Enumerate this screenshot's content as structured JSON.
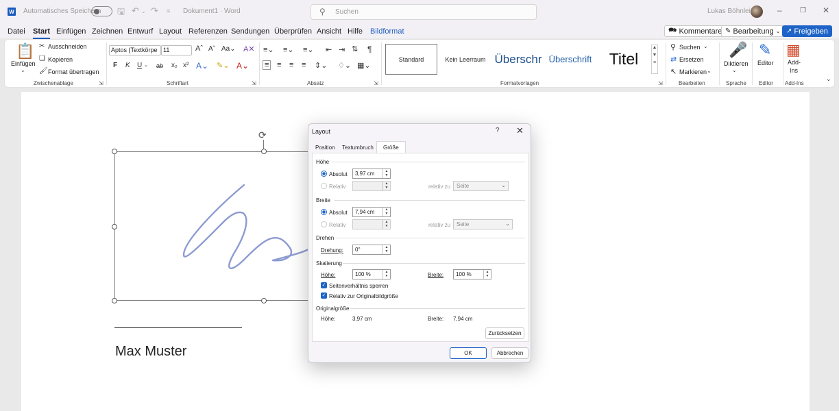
{
  "titlebar": {
    "autosave_label": "Automatisches Speichern",
    "document_name": "Dokument1 · Word",
    "search_placeholder": "Suchen",
    "user_name": "Lukas Böhnlein"
  },
  "menu": {
    "tabs": [
      "Datei",
      "Start",
      "Einfügen",
      "Zeichnen",
      "Entwurf",
      "Layout",
      "Referenzen",
      "Sendungen",
      "Überprüfen",
      "Ansicht",
      "Hilfe",
      "Bildformat"
    ],
    "active_tab": "Start",
    "comments_label": "Kommentare",
    "editing_label": "Bearbeitung",
    "share_label": "Freigeben"
  },
  "ribbon": {
    "clipboard": {
      "paste": "Einfügen",
      "cut": "Ausschneiden",
      "copy": "Kopieren",
      "format_painter": "Format übertragen",
      "label": "Zwischenablage"
    },
    "font": {
      "font_name": "Aptos (Textkörpe",
      "font_size": "11",
      "bold": "F",
      "italic": "K",
      "underline": "U",
      "strike": "ab",
      "subscript": "x₂",
      "superscript": "x²",
      "label": "Schriftart"
    },
    "paragraph": {
      "label": "Absatz"
    },
    "styles": {
      "items": [
        "Standard",
        "Kein Leerraum",
        "Überschr",
        "Überschrift",
        "Titel"
      ],
      "label": "Formatvorlagen"
    },
    "editing": {
      "find": "Suchen",
      "replace": "Ersetzen",
      "select": "Markieren",
      "label": "Bearbeiten"
    },
    "voice": {
      "dictate": "Diktieren",
      "label": "Sprache"
    },
    "editor": {
      "button": "Editor",
      "label": "Editor"
    },
    "addins": {
      "button_line1": "Add-",
      "button_line2": "Ins",
      "label": "Add-Ins"
    }
  },
  "document": {
    "signer_name": "Max Muster"
  },
  "dialog": {
    "title": "Layout",
    "help": "?",
    "tabs": [
      "Position",
      "Textumbruch",
      "Größe"
    ],
    "active_tab": "Größe",
    "height_section": "Höhe",
    "width_section": "Breite",
    "absolute_label": "Absolut",
    "relative_label": "Relativ",
    "relative_to_label": "relativ zu",
    "relative_to_value": "Seite",
    "height_absolute": "3,97 cm",
    "width_absolute": "7,94 cm",
    "rotate_section": "Drehen",
    "rotation_label": "Drehung:",
    "rotation_value": "0°",
    "scale_section": "Skalierung",
    "scale_height_label": "Höhe:",
    "scale_height_value": "100 %",
    "scale_width_label": "Breite:",
    "scale_width_value": "100 %",
    "lock_aspect_label": "Seitenverhältnis sperren",
    "lock_aspect_checked": true,
    "relative_original_label": "Relativ zur Originalbildgröße",
    "relative_original_checked": true,
    "original_section": "Originalgröße",
    "original_height_label": "Höhe:",
    "original_height_value": "3,97 cm",
    "original_width_label": "Breite:",
    "original_width_value": "7,94 cm",
    "reset_label": "Zurücksetzen",
    "ok_label": "OK",
    "cancel_label": "Abbrechen"
  },
  "colors": {
    "accent": "#185abd",
    "signature_ink": "#8d9bd1"
  }
}
